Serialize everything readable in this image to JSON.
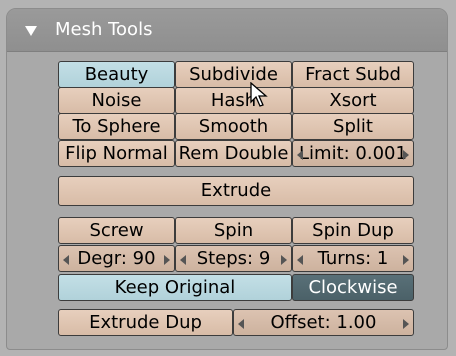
{
  "panel": {
    "title": "Mesh Tools"
  },
  "row1": {
    "beauty": "Beauty",
    "subdivide": "Subdivide",
    "fract_subd": "Fract Subd"
  },
  "row2": {
    "noise": "Noise",
    "hash": "Hash",
    "xsort": "Xsort"
  },
  "row3": {
    "to_sphere": "To Sphere",
    "smooth": "Smooth",
    "split": "Split"
  },
  "row4": {
    "flip_normal": "Flip Normal",
    "rem_double": "Rem Double",
    "limit": "Limit: 0.001"
  },
  "extrude": "Extrude",
  "spin_group": {
    "screw": "Screw",
    "spin": "Spin",
    "spin_dup": "Spin Dup",
    "degr": "Degr: 90",
    "steps": "Steps: 9",
    "turns": "Turns: 1",
    "keep_original": "Keep Original",
    "clockwise": "Clockwise"
  },
  "bottom": {
    "extrude_dup": "Extrude Dup",
    "offset": "Offset: 1.00"
  }
}
